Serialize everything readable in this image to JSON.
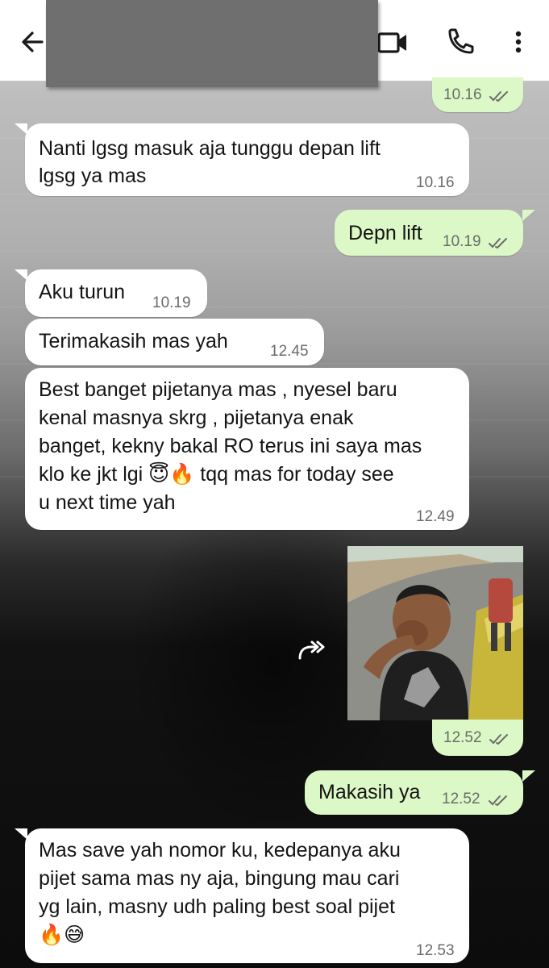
{
  "header": {
    "back_icon": "arrow-left-icon",
    "contact_name": "",
    "actions": [
      "video-call-icon",
      "phone-icon",
      "more-vert-icon"
    ]
  },
  "messages": [
    {
      "dir": "out",
      "text": "",
      "time": "10.16",
      "ticks": "double-check"
    },
    {
      "dir": "in",
      "text": "Nanti lgsg masuk aja tunggu depan lift\nlgsg ya mas",
      "time": "10.16"
    },
    {
      "dir": "out",
      "text": "Depn lift",
      "time": "10.19",
      "ticks": "double-check"
    },
    {
      "dir": "in",
      "text": "Aku turun",
      "time": "10.19"
    },
    {
      "dir": "in",
      "text": "Terimakasih mas yah",
      "time": "12.45"
    },
    {
      "dir": "in",
      "text": "Best banget pijetanya mas , nyesel baru\nkenal masnya skrg , pijetanya enak\nbanget, kekny bakal RO terus ini saya mas\nklo ke jkt lgi 😇🔥 tqq mas for today see\nu next time yah",
      "time": "12.49"
    },
    {
      "dir": "out",
      "type": "image",
      "image_desc": "photo",
      "time": "12.52",
      "ticks": "double-check"
    },
    {
      "dir": "out",
      "text": "Makasih ya",
      "time": "12.52",
      "ticks": "double-check"
    },
    {
      "dir": "in",
      "text": "Mas save yah nomor ku, kedepanya aku\npijet sama mas ny aja, bingung mau cari\nyg lain, masny udh paling best soal pijet\n🔥😅",
      "time": "12.53"
    }
  ],
  "colors": {
    "incoming_bubble": "#ffffff",
    "outgoing_bubble": "#dcf8c6",
    "header_bg": "#ffffff",
    "redaction": "#6f6f6f"
  }
}
